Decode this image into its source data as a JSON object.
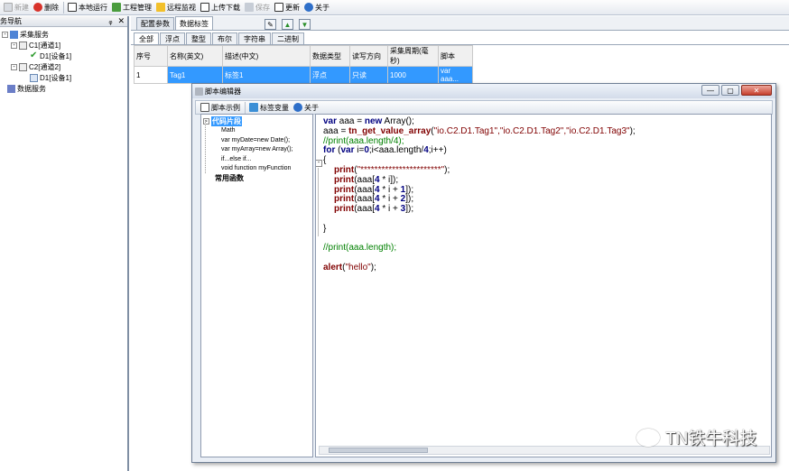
{
  "toolbar": {
    "new": "新建",
    "delete": "删除",
    "local_run": "本地运行",
    "project": "工程管理",
    "remote": "远程监视",
    "upload": "上传下载",
    "save": "保存",
    "update": "更新",
    "about": "关于"
  },
  "nav": {
    "title": "务导航",
    "pin": "ᵩ",
    "close": "✕",
    "tree": {
      "collect": "采集服务",
      "c1": "C1[通道1]",
      "d1a": "D1[设备1]",
      "c2": "C2[通道2]",
      "d1b": "D1[设备1]",
      "data": "数据服务"
    }
  },
  "tabs": {
    "config": "配置参数",
    "tags": "数据标签"
  },
  "type_tabs": [
    "全部",
    "浮点",
    "整型",
    "布尔",
    "字符串",
    "二进制"
  ],
  "grid": {
    "headers": [
      "序号",
      "名称(英文)",
      "描述(中文)",
      "数据类型",
      "读写方向",
      "采集周期(毫秒)",
      "脚本"
    ],
    "rows": [
      [
        "1",
        "Tag1",
        "标签1",
        "浮点",
        "只读",
        "1000",
        "var aaa..."
      ]
    ]
  },
  "dialog": {
    "title": "脚本编辑器",
    "toolbar": {
      "example": "脚本示例",
      "tagvar": "标签变量",
      "about": "关于"
    },
    "snippets": {
      "section": "代码片段",
      "items": [
        "Math",
        "var myDate=new Date();",
        "var myArray=new Array();",
        "if...else if...",
        "void function myFunction"
      ],
      "common": "常用函数"
    }
  },
  "code": {
    "l1_a": "var",
    "l1_b": " aaa = ",
    "l1_c": "new",
    "l1_d": " Array();",
    "l2_a": "aaa = ",
    "l2_b": "tn_get_value_array",
    "l2_c": "(",
    "l2_d": "\"io.C2.D1.Tag1\",\"io.C2.D1.Tag2\",\"io.C2.D1.Tag3\"",
    "l2_e": ");",
    "l3": "//print(aaa.length/4);",
    "l4_a": "for",
    "l4_b": " (",
    "l4_c": "var",
    "l4_d": " i=",
    "l4_e": "0",
    "l4_f": ";i<aaa.length/",
    "l4_g": "4",
    "l4_h": ";i++)",
    "l5": "{",
    "p1_a": "print",
    "p1_b": "(",
    "p1_c": "\"***********************\"",
    "p1_d": ");",
    "p2_a": "print",
    "p2_b": "(aaa[",
    "p2_c": "4",
    "p2_d": " * i]);",
    "p3_a": "print",
    "p3_b": "(aaa[",
    "p3_c": "4",
    "p3_d": " * i + ",
    "p3_e": "1",
    "p3_f": "]);",
    "p4_a": "print",
    "p4_b": "(aaa[",
    "p4_c": "4",
    "p4_d": " * i + ",
    "p4_e": "2",
    "p4_f": "]);",
    "p5_a": "print",
    "p5_b": "(aaa[",
    "p5_c": "4",
    "p5_d": " * i + ",
    "p5_e": "3",
    "p5_f": "]);",
    "l11": "}",
    "l13": "//print(aaa.length);",
    "l15_a": "alert",
    "l15_b": "(",
    "l15_c": "\"hello\"",
    "l15_d": ");"
  },
  "watermark": "TN铁牛科技"
}
